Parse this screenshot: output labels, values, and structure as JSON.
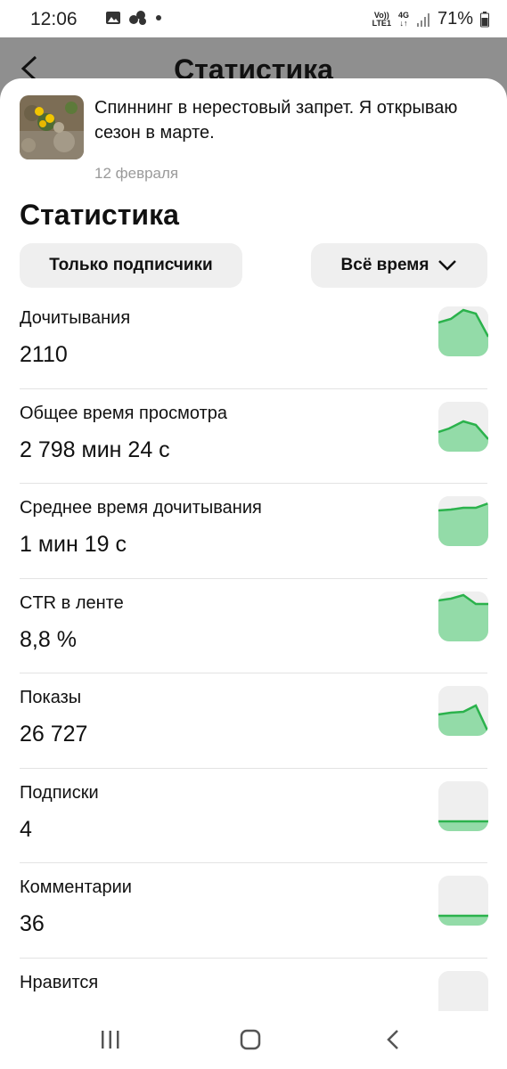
{
  "status_bar": {
    "time": "12:06",
    "network_top": "Vo))",
    "network_bottom": "LTE1",
    "network_type": "4G",
    "battery": "71%"
  },
  "backdrop": {
    "title": "Статистика"
  },
  "post": {
    "title": "Спиннинг в нерестовый запрет. Я открываю сезон в марте.",
    "date": "12 февраля"
  },
  "stats": {
    "title": "Статистика",
    "filter_label": "Только подписчики",
    "period_label": "Всё время"
  },
  "metrics": [
    {
      "label": "Дочитывания",
      "value": "2110"
    },
    {
      "label": "Общее время просмотра",
      "value": "2 798 мин 24 с"
    },
    {
      "label": "Среднее время дочитывания",
      "value": "1 мин 19 с"
    },
    {
      "label": "CTR в ленте",
      "value": "8,8 %"
    },
    {
      "label": "Показы",
      "value": "26 727"
    },
    {
      "label": "Подписки",
      "value": "4"
    },
    {
      "label": "Комментарии",
      "value": "36"
    },
    {
      "label": "Нравится",
      "value": ""
    }
  ],
  "colors": {
    "sparkline_line": "#2bb24c",
    "sparkline_fill": "#93dba8",
    "button_bg": "#efefef",
    "backdrop": "#8f8f8f"
  }
}
